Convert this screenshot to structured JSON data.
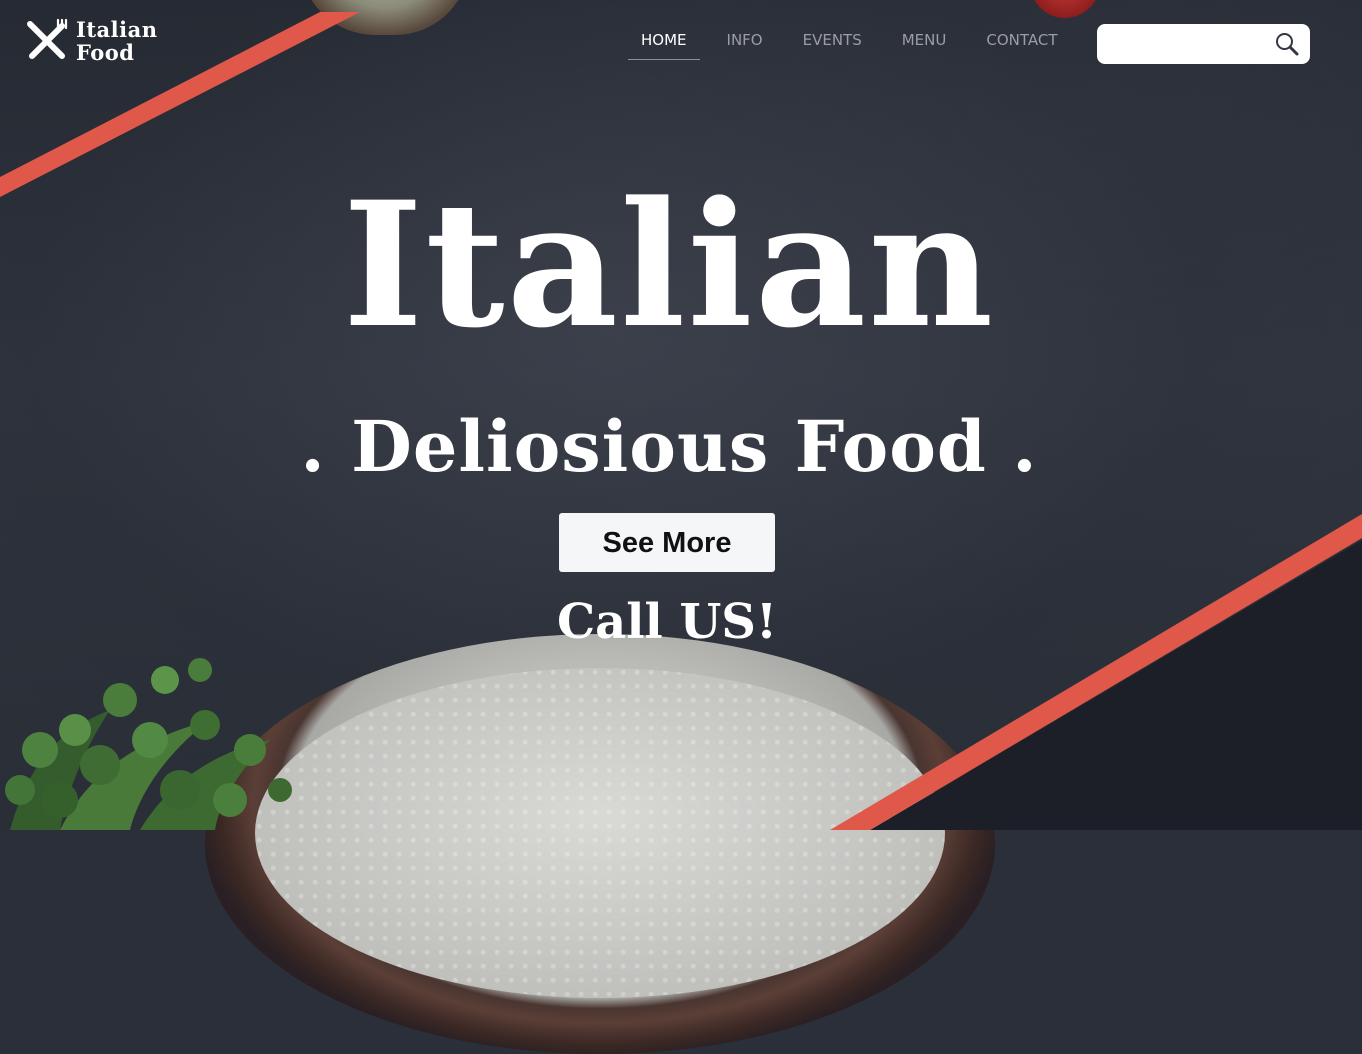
{
  "brand": {
    "line1": "Italian",
    "line2": "Food"
  },
  "nav": {
    "items": [
      {
        "label": "HOME",
        "active": true
      },
      {
        "label": "INFO",
        "active": false
      },
      {
        "label": "EVENTS",
        "active": false
      },
      {
        "label": "MENU",
        "active": false
      },
      {
        "label": "CONTACT",
        "active": false
      }
    ]
  },
  "search": {
    "value": "",
    "placeholder": ""
  },
  "hero": {
    "title": "Italian",
    "subtitle": ". Deliosious Food .",
    "button_label": "See More",
    "call_label": "Call US!"
  },
  "colors": {
    "accent_stripe": "#e0584a",
    "background": "#2b2f39",
    "dark_corner": "#1c1f27",
    "text": "#ffffff",
    "nav_inactive": "#9a9da6"
  },
  "icons": {
    "logo": "crossed-fork-knife-icon",
    "search": "magnifier-icon"
  }
}
